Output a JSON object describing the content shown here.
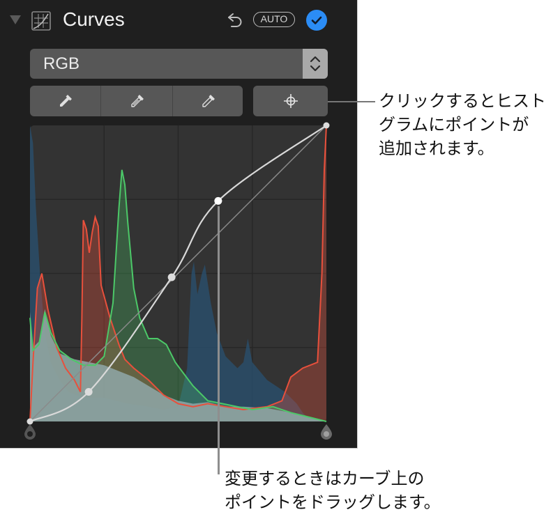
{
  "panel": {
    "title": "Curves",
    "icons": {
      "disclosure": "disclosure-triangle-down",
      "section": "curves-icon",
      "undo": "undo-arrow-icon",
      "confirm": "checkmark-circle-icon"
    },
    "auto_label": "AUTO",
    "checked": true,
    "accent_color": "#2b8cf5"
  },
  "channel_select": {
    "selected": "RGB",
    "icon": "up-down-chevron-icon"
  },
  "pickers": [
    {
      "name": "black-point-eyedropper",
      "icon": "eyedropper-filled-icon"
    },
    {
      "name": "gray-point-eyedropper",
      "icon": "eyedropper-half-icon"
    },
    {
      "name": "white-point-eyedropper",
      "icon": "eyedropper-outline-icon"
    }
  ],
  "add_point_button": {
    "icon": "crosshair-target-icon"
  },
  "histogram": {
    "colors": {
      "red": "#e8503c",
      "green": "#4cc868",
      "blue": "#2a4b66",
      "luminance": "#8fa7a8",
      "curve": "#d9d9d9"
    },
    "grid_divisions": 4,
    "channels": {
      "blue": [
        [
          0,
          1
        ],
        [
          0.01,
          0.94
        ],
        [
          0.02,
          0.72
        ],
        [
          0.035,
          0.48
        ],
        [
          0.05,
          0.3
        ],
        [
          0.07,
          0.2
        ],
        [
          0.1,
          0.14
        ],
        [
          0.13,
          0.1
        ],
        [
          0.18,
          0.08
        ],
        [
          0.25,
          0.08
        ],
        [
          0.33,
          0.06
        ],
        [
          0.4,
          0.05
        ],
        [
          0.45,
          0.04
        ],
        [
          0.5,
          0.05
        ],
        [
          0.53,
          0.18
        ],
        [
          0.545,
          0.5
        ],
        [
          0.553,
          0.54
        ],
        [
          0.565,
          0.43
        ],
        [
          0.58,
          0.5
        ],
        [
          0.59,
          0.53
        ],
        [
          0.61,
          0.4
        ],
        [
          0.63,
          0.3
        ],
        [
          0.66,
          0.22
        ],
        [
          0.7,
          0.18
        ],
        [
          0.72,
          0.2
        ],
        [
          0.735,
          0.28
        ],
        [
          0.75,
          0.2
        ],
        [
          0.8,
          0.14
        ],
        [
          0.86,
          0.1
        ],
        [
          0.9,
          0.06
        ],
        [
          0.92,
          0.03
        ],
        [
          0.94,
          0.01
        ],
        [
          1,
          0
        ]
      ],
      "red": [
        [
          0,
          0.0
        ],
        [
          0.01,
          0.2
        ],
        [
          0.025,
          0.45
        ],
        [
          0.04,
          0.5
        ],
        [
          0.06,
          0.38
        ],
        [
          0.09,
          0.25
        ],
        [
          0.12,
          0.18
        ],
        [
          0.15,
          0.14
        ],
        [
          0.17,
          0.1
        ],
        [
          0.175,
          0.35
        ],
        [
          0.18,
          0.68
        ],
        [
          0.19,
          0.65
        ],
        [
          0.2,
          0.57
        ],
        [
          0.21,
          0.64
        ],
        [
          0.22,
          0.69
        ],
        [
          0.23,
          0.66
        ],
        [
          0.24,
          0.46
        ],
        [
          0.27,
          0.35
        ],
        [
          0.3,
          0.26
        ],
        [
          0.32,
          0.21
        ],
        [
          0.35,
          0.18
        ],
        [
          0.4,
          0.14
        ],
        [
          0.45,
          0.09
        ],
        [
          0.5,
          0.06
        ],
        [
          0.55,
          0.05
        ],
        [
          0.6,
          0.06
        ],
        [
          0.66,
          0.05
        ],
        [
          0.72,
          0.04
        ],
        [
          0.8,
          0.05
        ],
        [
          0.85,
          0.07
        ],
        [
          0.88,
          0.15
        ],
        [
          0.92,
          0.18
        ],
        [
          0.97,
          0.2
        ],
        [
          0.985,
          0.5
        ],
        [
          0.993,
          0.85
        ],
        [
          1,
          1
        ]
      ],
      "green": [
        [
          0,
          0.35
        ],
        [
          0.01,
          0.24
        ],
        [
          0.03,
          0.26
        ],
        [
          0.05,
          0.37
        ],
        [
          0.07,
          0.3
        ],
        [
          0.1,
          0.24
        ],
        [
          0.14,
          0.21
        ],
        [
          0.18,
          0.19
        ],
        [
          0.22,
          0.19
        ],
        [
          0.25,
          0.22
        ],
        [
          0.28,
          0.4
        ],
        [
          0.3,
          0.72
        ],
        [
          0.31,
          0.85
        ],
        [
          0.32,
          0.8
        ],
        [
          0.33,
          0.67
        ],
        [
          0.35,
          0.45
        ],
        [
          0.37,
          0.35
        ],
        [
          0.4,
          0.28
        ],
        [
          0.43,
          0.28
        ],
        [
          0.46,
          0.26
        ],
        [
          0.49,
          0.2
        ],
        [
          0.52,
          0.16
        ],
        [
          0.55,
          0.12
        ],
        [
          0.6,
          0.07
        ],
        [
          0.65,
          0.06
        ],
        [
          0.7,
          0.05
        ],
        [
          0.75,
          0.04
        ],
        [
          0.82,
          0.05
        ],
        [
          0.88,
          0.03
        ],
        [
          0.94,
          0.015
        ],
        [
          1,
          0
        ]
      ],
      "luminance": [
        [
          0,
          0.37
        ],
        [
          0.01,
          0.25
        ],
        [
          0.03,
          0.27
        ],
        [
          0.05,
          0.38
        ],
        [
          0.07,
          0.29
        ],
        [
          0.1,
          0.23
        ],
        [
          0.15,
          0.21
        ],
        [
          0.2,
          0.2
        ],
        [
          0.25,
          0.19
        ],
        [
          0.3,
          0.17
        ],
        [
          0.35,
          0.15
        ],
        [
          0.4,
          0.12
        ],
        [
          0.45,
          0.09
        ],
        [
          0.5,
          0.07
        ],
        [
          0.55,
          0.06
        ],
        [
          0.6,
          0.065
        ],
        [
          0.66,
          0.05
        ],
        [
          0.72,
          0.05
        ],
        [
          0.8,
          0.045
        ],
        [
          0.88,
          0.03
        ],
        [
          0.94,
          0.015
        ],
        [
          1,
          0
        ]
      ]
    },
    "curve_points": [
      [
        0,
        0
      ],
      [
        0.198,
        0.1
      ],
      [
        0.478,
        0.487
      ],
      [
        0.635,
        0.745
      ],
      [
        1,
        1
      ]
    ]
  },
  "callouts": {
    "add_point": "クリックするとヒスト\nグラムにポイントが\n追加されます。",
    "drag_point": "変更するときはカーブ上の\nポイントをドラッグします。"
  }
}
